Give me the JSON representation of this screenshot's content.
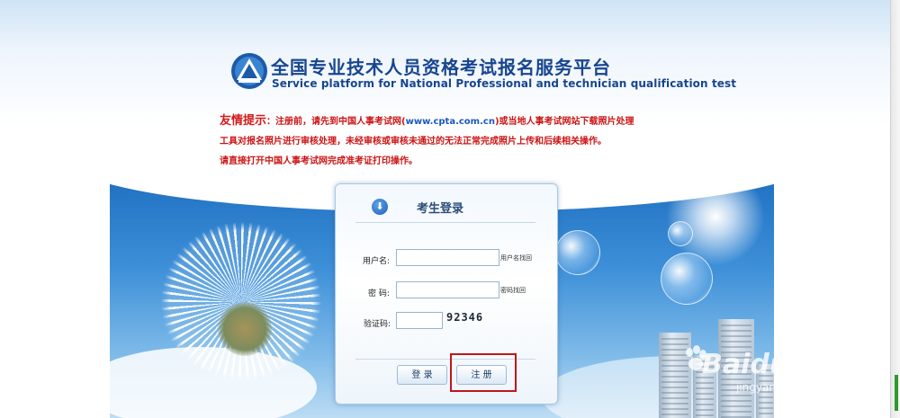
{
  "header": {
    "title_cn": "全国专业技术人员资格考试报名服务平台",
    "title_en": "Service platform for National Professional and technician qualification test"
  },
  "notice": {
    "lead": "友情提示",
    "text1": "：注册前，请先到中国人事考试网(",
    "url": "www.cpta.com.cn",
    "text2": ")或当地人事考试网站下载照片处理",
    "line2": "工具对报名照片进行审核处理，未经审核或审核未通过的无法正常完成照片上传和后续相关操作。",
    "line3": "请直接打开中国人事考试网完成准考证打印操作。"
  },
  "login": {
    "title": "考生登录",
    "username_label": "用户名:",
    "username_value": "",
    "username_hint": "用户名找回",
    "password_label": "密 码:",
    "password_value": "",
    "password_hint": "密码找回",
    "captcha_label": "验证码:",
    "captcha_value": "",
    "captcha_image_text": "92346",
    "login_button": "登 录",
    "register_button": "注 册"
  },
  "watermark": {
    "brand": "Baidu 经验",
    "url": "jingyan.baidu.com"
  },
  "colors": {
    "title_blue": "#17458f",
    "notice_red": "#cc1414",
    "highlight_red": "#c0161c"
  }
}
